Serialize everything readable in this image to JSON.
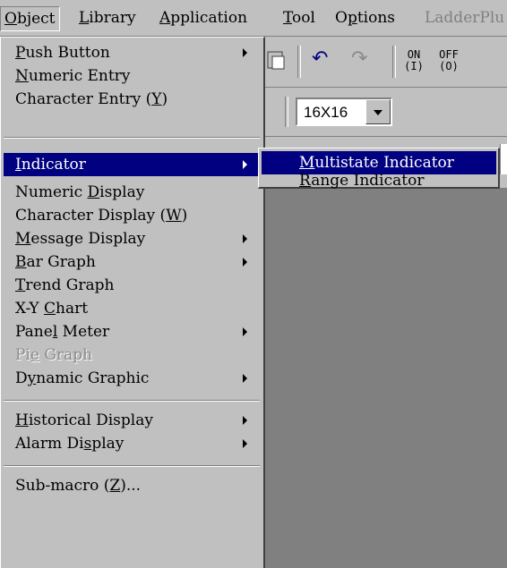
{
  "menubar": {
    "items": [
      {
        "key": "object",
        "pre": "",
        "u": "O",
        "post": "bject"
      },
      {
        "key": "library",
        "pre": "",
        "u": "L",
        "post": "ibrary"
      },
      {
        "key": "application",
        "pre": "",
        "u": "A",
        "post": "pplication"
      },
      {
        "key": "tool",
        "pre": "",
        "u": "T",
        "post": "ool"
      },
      {
        "key": "options",
        "pre": "O",
        "u": "p",
        "post": "tions"
      },
      {
        "key": "ladderplus",
        "pre": "LadderPlu",
        "u": "",
        "post": ""
      }
    ]
  },
  "toolbar": {
    "on_top": "ON",
    "on_bottom": "(I)",
    "off_top": "OFF",
    "off_bottom": "(O)",
    "grid_size": "16X16"
  },
  "object_menu": {
    "items": [
      {
        "pre": "",
        "u": "P",
        "post": "ush Button",
        "submenu": true
      },
      {
        "pre": "",
        "u": "N",
        "post": "umeric Entry",
        "submenu": false
      },
      {
        "pre": "Character Entry (",
        "u": "Y",
        "post": ")",
        "submenu": false
      },
      {
        "pre": "",
        "u": "I",
        "post": "ndicator",
        "submenu": true
      },
      {
        "pre": "Numeric ",
        "u": "D",
        "post": "isplay",
        "submenu": false
      },
      {
        "pre": "Character Display (",
        "u": "W",
        "post": ")",
        "submenu": false
      },
      {
        "pre": "",
        "u": "M",
        "post": "essage Display",
        "submenu": true
      },
      {
        "pre": "",
        "u": "B",
        "post": "ar Graph",
        "submenu": true
      },
      {
        "pre": "",
        "u": "T",
        "post": "rend Graph",
        "submenu": false
      },
      {
        "pre": "X-Y ",
        "u": "C",
        "post": "hart",
        "submenu": false
      },
      {
        "pre": "Pane",
        "u": "l",
        "post": " Meter",
        "submenu": true
      },
      {
        "pre": "Pi",
        "u": "e",
        "post": " Graph",
        "submenu": false
      },
      {
        "pre": "D",
        "u": "y",
        "post": "namic Graphic",
        "submenu": true
      },
      {
        "pre": "",
        "u": "H",
        "post": "istorical Display",
        "submenu": true
      },
      {
        "pre": "Alarm Di",
        "u": "s",
        "post": "play",
        "submenu": true
      },
      {
        "pre": "Sub-macro (",
        "u": "Z",
        "post": ")...",
        "submenu": false
      }
    ]
  },
  "indicator_submenu": {
    "items": [
      {
        "pre": "",
        "u": "M",
        "post": "ultistate Indicator"
      },
      {
        "pre": "",
        "u": "R",
        "post": "ange Indicator"
      }
    ]
  }
}
